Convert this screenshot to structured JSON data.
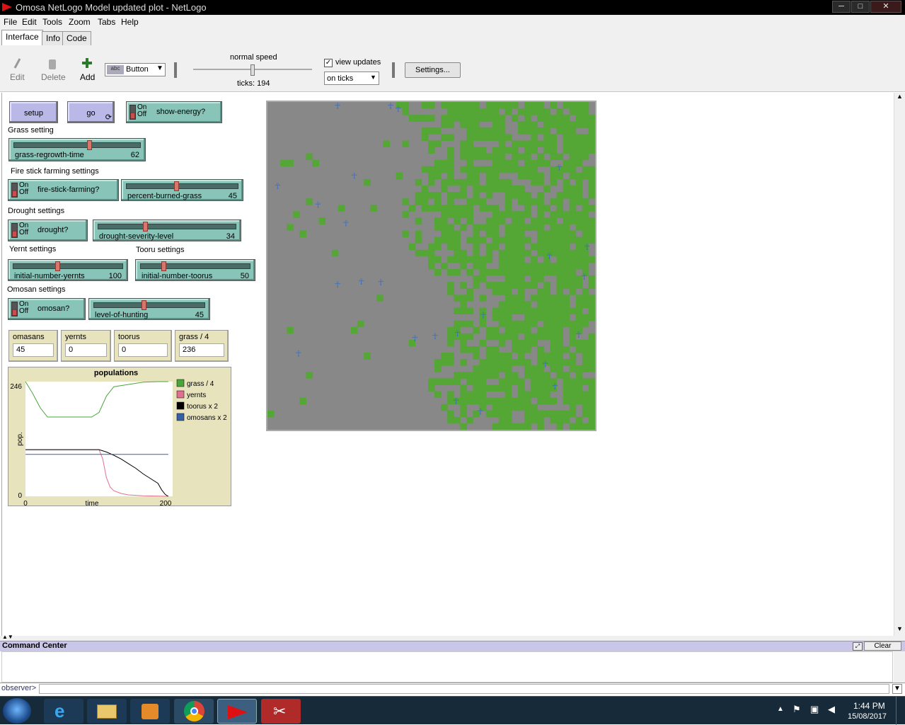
{
  "window": {
    "title": "Omosa NetLogo Model updated plot - NetLogo",
    "controls": {
      "minimize": "─",
      "maximize": "□",
      "close": "✕"
    }
  },
  "menu": [
    "File",
    "Edit",
    "Tools",
    "Zoom",
    "Tabs",
    "Help"
  ],
  "tabs": [
    "Interface",
    "Info",
    "Code"
  ],
  "toolbar": {
    "edit": "Edit",
    "delete": "Delete",
    "add": "Add",
    "widget_type": "Button",
    "speed_label": "normal speed",
    "ticks": "ticks: 194",
    "speed_value": 0.5,
    "view_updates_label": "view updates",
    "view_updates_checked": true,
    "update_mode": "on ticks",
    "settings": "Settings..."
  },
  "widgets": {
    "setup": "setup",
    "go": "go",
    "show_energy": {
      "label": "show-energy?",
      "on": "On",
      "off": "Off"
    },
    "grass_note": "Grass setting",
    "grass_regrowth": {
      "name": "grass-regrowth-time",
      "value": "62",
      "fraction": 0.6
    },
    "fire_note": "Fire stick farming settings",
    "fire_stick": {
      "label": "fire-stick-farming?",
      "on": "On",
      "off": "Off"
    },
    "percent_burned": {
      "name": "percent-burned-grass",
      "value": "45",
      "fraction": 0.45
    },
    "drought_note": "Drought settings",
    "drought": {
      "label": "drought?",
      "on": "On",
      "off": "Off"
    },
    "drought_severity": {
      "name": "drought-severity-level",
      "value": "34",
      "fraction": 0.34
    },
    "yernt_note": "Yernt settings",
    "tooru_note": "Tooru settings",
    "init_yernts": {
      "name": "initial-number-yernts",
      "value": "100",
      "fraction": 0.4
    },
    "init_toorus": {
      "name": "initial-number-toorus",
      "value": "50",
      "fraction": 0.2
    },
    "omosan_note": "Omosan settings",
    "omosan": {
      "label": "omosan?",
      "on": "On",
      "off": "Off"
    },
    "level_hunting": {
      "name": "level-of-hunting",
      "value": "45",
      "fraction": 0.45
    }
  },
  "monitors": [
    {
      "name": "omasans",
      "value": "45"
    },
    {
      "name": "yernts",
      "value": "0"
    },
    {
      "name": "toorus",
      "value": "0"
    },
    {
      "name": "grass / 4",
      "value": "236"
    }
  ],
  "chart_data": {
    "type": "line",
    "title": "populations",
    "xlabel": "time",
    "ylabel": "pop.",
    "xlim": [
      0,
      200
    ],
    "ylim": [
      0,
      246
    ],
    "x_ticks": [
      "0",
      "200"
    ],
    "y_ticks": [
      "0",
      "246"
    ],
    "legend_position": "right",
    "series": [
      {
        "name": "grass / 4",
        "color": "#4aa63b",
        "x": [
          0,
          10,
          20,
          30,
          60,
          90,
          100,
          110,
          120,
          140,
          160,
          180,
          194
        ],
        "y": [
          246,
          220,
          190,
          170,
          170,
          170,
          180,
          215,
          235,
          240,
          245,
          246,
          246
        ]
      },
      {
        "name": "yernts",
        "color": "#e07090",
        "x": [
          0,
          100,
          105,
          110,
          115,
          120,
          130,
          140,
          160,
          194
        ],
        "y": [
          100,
          100,
          80,
          40,
          20,
          12,
          6,
          3,
          1,
          0
        ]
      },
      {
        "name": "toorus x 2",
        "color": "#000000",
        "x": [
          0,
          100,
          110,
          120,
          130,
          140,
          150,
          160,
          170,
          180,
          185,
          190,
          194
        ],
        "y": [
          100,
          100,
          95,
          88,
          80,
          70,
          60,
          48,
          38,
          28,
          14,
          4,
          0
        ]
      },
      {
        "name": "omosans x 2",
        "color": "#3560a8",
        "x": [
          0,
          194
        ],
        "y": [
          90,
          90
        ]
      }
    ]
  },
  "command_center": {
    "title": "Command Center",
    "clear": "Clear",
    "prompt": "observer>"
  },
  "taskbar": {
    "time": "1:44 PM",
    "date": "15/08/2017"
  }
}
